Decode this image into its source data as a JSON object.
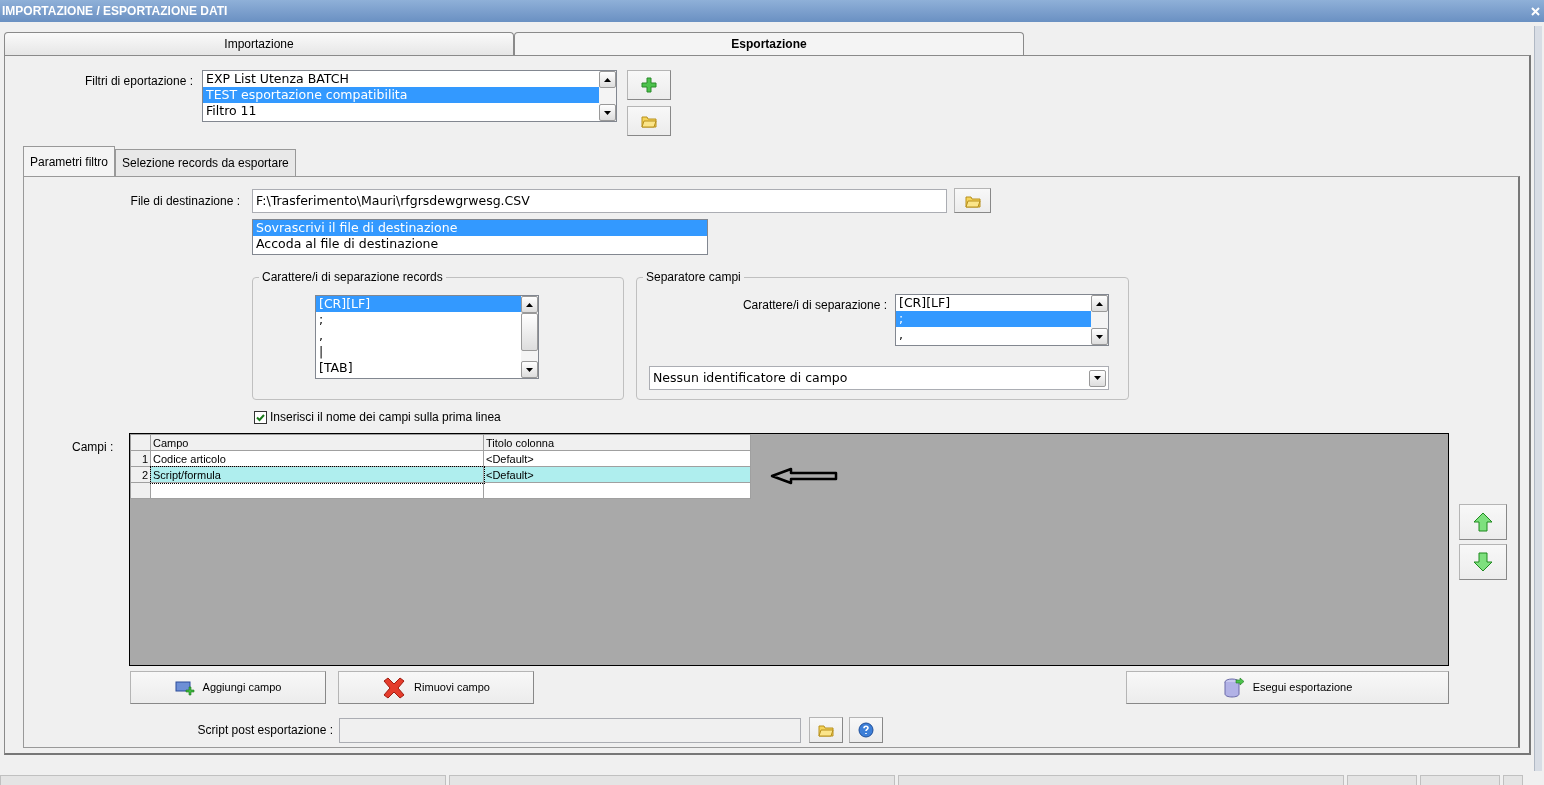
{
  "window": {
    "title": "IMPORTAZIONE / ESPORTAZIONE DATI"
  },
  "tabs": [
    {
      "label": "Importazione",
      "selected": false
    },
    {
      "label": "Esportazione",
      "selected": true
    }
  ],
  "filters": {
    "label": "Filtri di eportazione :",
    "items": [
      {
        "label": "EXP List Utenza BATCH",
        "selected": false
      },
      {
        "label": "TEST esportazione compatibilita",
        "selected": true
      },
      {
        "label": "Filtro 11",
        "selected": false
      }
    ]
  },
  "subtabs": [
    {
      "label": "Parametri filtro",
      "selected": true
    },
    {
      "label": "Selezione records da esportare",
      "selected": false
    }
  ],
  "destination": {
    "label": "File di destinazione :",
    "value": "F:\\Trasferimento\\Mauri\\rfgrsdewgrwesg.CSV"
  },
  "write_modes": [
    {
      "label": "Sovrascrivi il file di destinazione",
      "selected": true
    },
    {
      "label": "Accoda al file di destinazione",
      "selected": false
    }
  ],
  "record_separator": {
    "title": "Carattere/i di separazione records",
    "items": [
      {
        "label": "[CR][LF]",
        "selected": true
      },
      {
        "label": ";",
        "selected": false
      },
      {
        "label": ",",
        "selected": false
      },
      {
        "label": "|",
        "selected": false
      },
      {
        "label": "[TAB]",
        "selected": false
      }
    ]
  },
  "field_separator": {
    "title": "Separatore campi",
    "label": "Carattere/i di separazione :",
    "items": [
      {
        "label": "[CR][LF]",
        "selected": false
      },
      {
        "label": ";",
        "selected": true
      },
      {
        "label": ",",
        "selected": false
      }
    ],
    "identifier": "Nessun identificatore di campo"
  },
  "header_checkbox": {
    "label": "Inserisci il nome dei campi sulla prima linea",
    "checked": true
  },
  "fields": {
    "label": "Campi :",
    "columns": [
      "Campo",
      "Titolo colonna"
    ],
    "rows": [
      {
        "number": "1",
        "field": "Codice articolo",
        "title": "<Default>",
        "selected": false
      },
      {
        "number": "2",
        "field": "Script/formula",
        "title": "<Default>",
        "selected": true
      }
    ]
  },
  "buttons": [
    {
      "label": "Aggiungi campo",
      "kind": "add"
    },
    {
      "label": "Rimuovi campo",
      "kind": "remove"
    },
    {
      "label": "Esegui esportazione",
      "kind": "run"
    }
  ],
  "script": {
    "label": "Script post esportazione :"
  }
}
